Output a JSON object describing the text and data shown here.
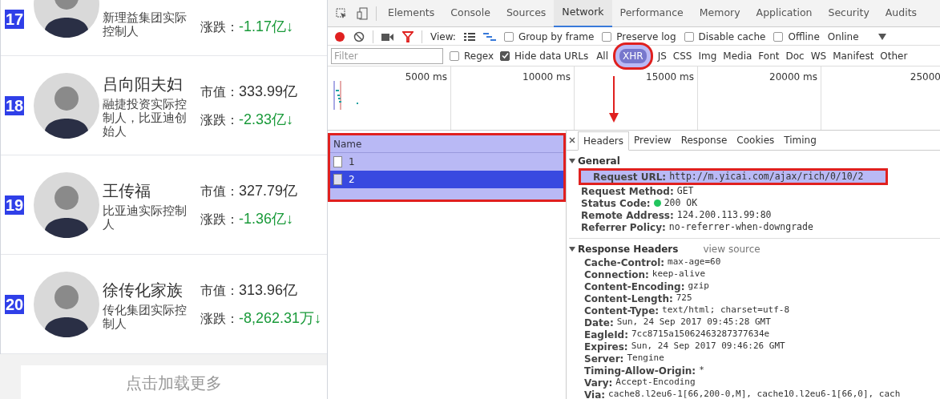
{
  "ranking": [
    {
      "rank": "17",
      "desc": "新理益集团实际控制人",
      "change_label": "涨跌：",
      "change": "-1.17亿↓"
    },
    {
      "rank": "18",
      "name": "吕向阳夫妇",
      "desc": "融捷投资实际控制人，比亚迪创始人",
      "value_label": "市值：",
      "value": "333.99亿",
      "change_label": "涨跌：",
      "change": "-2.33亿↓"
    },
    {
      "rank": "19",
      "name": "王传福",
      "desc": "比亚迪实际控制人",
      "value_label": "市值：",
      "value": "327.79亿",
      "change_label": "涨跌：",
      "change": "-1.36亿↓"
    },
    {
      "rank": "20",
      "name": "徐传化家族",
      "desc": "传化集团实际控制人",
      "value_label": "市值：",
      "value": "313.96亿",
      "change_label": "涨跌：",
      "change": "-8,262.31万↓"
    }
  ],
  "load_more": "点击加载更多",
  "devtools": {
    "tabs": [
      {
        "label": "Elements",
        "selected": false
      },
      {
        "label": "Console",
        "selected": false
      },
      {
        "label": "Sources",
        "selected": false
      },
      {
        "label": "Network",
        "selected": true
      },
      {
        "label": "Performance",
        "selected": false
      },
      {
        "label": "Memory",
        "selected": false
      },
      {
        "label": "Application",
        "selected": false
      },
      {
        "label": "Security",
        "selected": false
      },
      {
        "label": "Audits",
        "selected": false
      }
    ],
    "toolbar": {
      "view_label": "View:",
      "options": [
        {
          "label": "Group by frame",
          "checked": false
        },
        {
          "label": "Preserve log",
          "checked": false
        },
        {
          "label": "Disable cache",
          "checked": false
        },
        {
          "label": "Offline",
          "checked": false
        }
      ],
      "throttle": "Online"
    },
    "filter": {
      "placeholder": "Filter",
      "options": [
        {
          "label": "Regex",
          "checked": false
        },
        {
          "label": "Hide data URLs",
          "checked": true
        }
      ],
      "types": [
        {
          "label": "All",
          "selected": false
        },
        {
          "label": "XHR",
          "selected": true
        },
        {
          "label": "JS",
          "selected": false
        },
        {
          "label": "CSS",
          "selected": false
        },
        {
          "label": "Img",
          "selected": false
        },
        {
          "label": "Media",
          "selected": false
        },
        {
          "label": "Font",
          "selected": false
        },
        {
          "label": "Doc",
          "selected": false
        },
        {
          "label": "WS",
          "selected": false
        },
        {
          "label": "Manifest",
          "selected": false
        },
        {
          "label": "Other",
          "selected": false
        }
      ]
    },
    "timeline_ticks": [
      "5000 ms",
      "10000 ms",
      "15000 ms",
      "20000 ms",
      "25000"
    ],
    "requests": {
      "header": "Name",
      "rows": [
        {
          "name": "1",
          "selected": false
        },
        {
          "name": "2",
          "selected": true
        }
      ]
    },
    "detail_tabs": [
      {
        "label": "Headers",
        "selected": true
      },
      {
        "label": "Preview",
        "selected": false
      },
      {
        "label": "Response",
        "selected": false
      },
      {
        "label": "Cookies",
        "selected": false
      },
      {
        "label": "Timing",
        "selected": false
      }
    ],
    "general": {
      "title": "General",
      "expanded": true,
      "rows": [
        {
          "key": "Request URL:",
          "value": "http://m.yicai.com/ajax/rich/0/10/2",
          "highlighted": true
        },
        {
          "key": "Request Method:",
          "value": "GET",
          "highlighted": false
        },
        {
          "key": "Status Code:",
          "value": "200 OK",
          "highlighted": false,
          "color": "#22c55e"
        },
        {
          "key": "Remote Address:",
          "value": "124.200.113.99:80",
          "highlighted": false
        },
        {
          "key": "Referrer Policy:",
          "value": "no-referrer-when-downgrade",
          "highlighted": false
        }
      ]
    },
    "response_headers": {
      "title": "Response Headers",
      "expanded": true,
      "link": "view source",
      "rows": [
        {
          "key": "Cache-Control:",
          "value": "max-age=60"
        },
        {
          "key": "Connection:",
          "value": "keep-alive"
        },
        {
          "key": "Content-Encoding:",
          "value": "gzip"
        },
        {
          "key": "Content-Length:",
          "value": "725"
        },
        {
          "key": "Content-Type:",
          "value": "text/html; charset=utf-8"
        },
        {
          "key": "Date:",
          "value": "Sun, 24 Sep 2017 09:45:28 GMT"
        },
        {
          "key": "EagleId:",
          "value": "7cc8715a15062463287377634e"
        },
        {
          "key": "Expires:",
          "value": "Sun, 24 Sep 2017 09:46:26 GMT"
        },
        {
          "key": "Server:",
          "value": "Tengine"
        },
        {
          "key": "Timing-Allow-Origin:",
          "value": "*"
        },
        {
          "key": "Vary:",
          "value": "Accept-Encoding"
        },
        {
          "key": "Via:",
          "value": "cache8.l2eu6-1[66,200-0,M], cache10.l2eu6-1[66,0], cach"
        }
      ]
    }
  }
}
